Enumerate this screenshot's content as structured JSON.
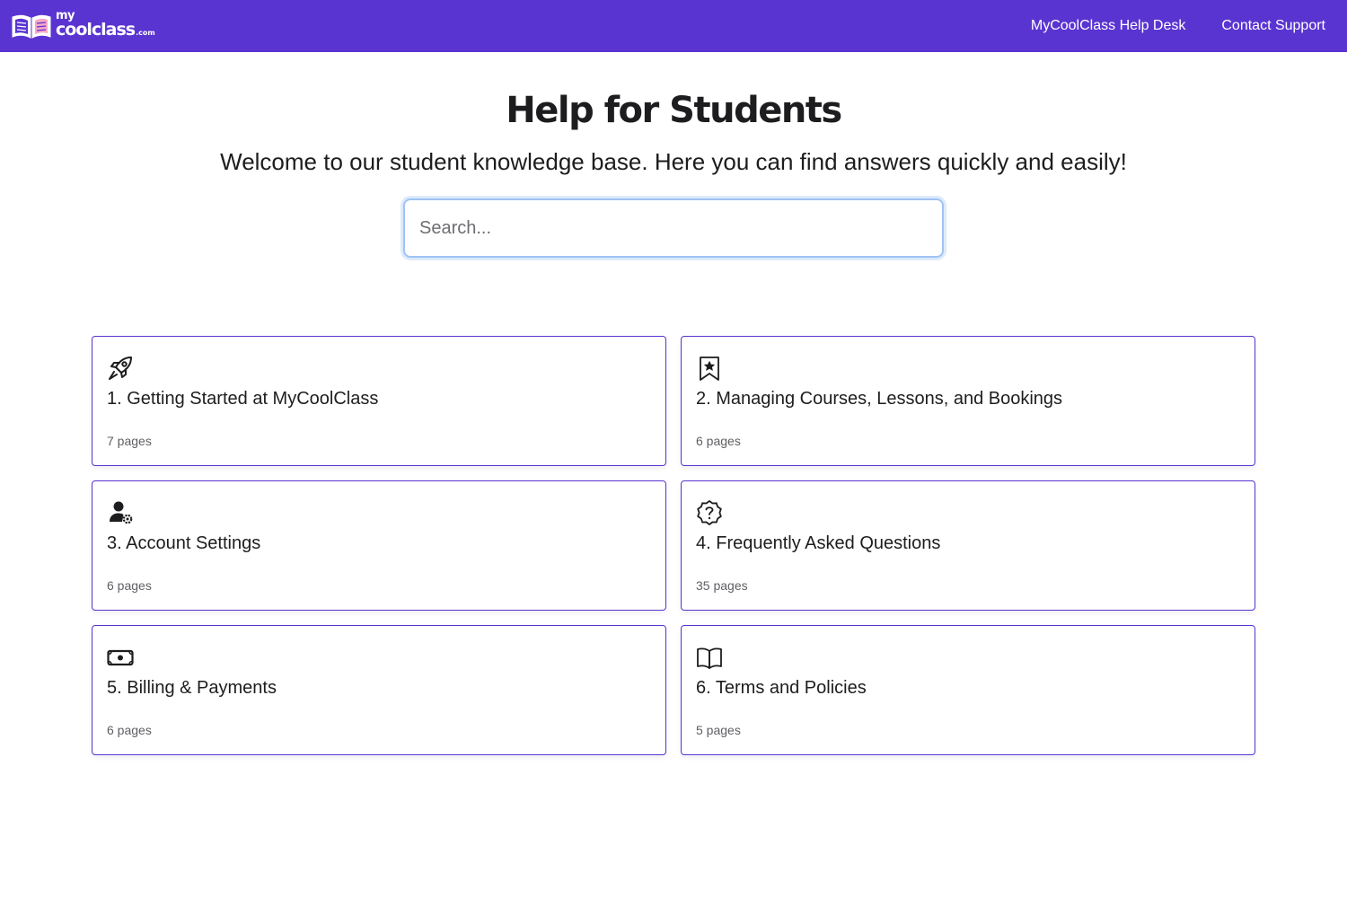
{
  "header": {
    "logo": {
      "my": "my",
      "main": "coolclass",
      "suffix": ".com"
    },
    "nav": [
      {
        "label": "MyCoolClass Help Desk"
      },
      {
        "label": "Contact Support"
      }
    ],
    "background_color": "#5a34d1"
  },
  "hero": {
    "title": "Help for Students",
    "subtitle": "Welcome to our student knowledge base. Here you can find answers quickly and easily!"
  },
  "search": {
    "placeholder": "Search...",
    "value": ""
  },
  "categories": [
    {
      "title": "1. Getting Started at MyCoolClass",
      "count": "7 pages",
      "icon": "rocket-icon"
    },
    {
      "title": "2. Managing Courses, Lessons, and Bookings",
      "count": "6 pages",
      "icon": "bookmark-star-icon"
    },
    {
      "title": "3. Account Settings",
      "count": "6 pages",
      "icon": "user-gear-icon"
    },
    {
      "title": "4. Frequently Asked Questions",
      "count": "35 pages",
      "icon": "question-badge-icon"
    },
    {
      "title": "5. Billing & Payments",
      "count": "6 pages",
      "icon": "cash-icon"
    },
    {
      "title": "6. Terms and Policies",
      "count": "5 pages",
      "icon": "open-book-icon"
    }
  ],
  "colors": {
    "accent": "#5a34d1",
    "card_border": "#5a34d1",
    "search_focus": "#9fc3f4"
  }
}
